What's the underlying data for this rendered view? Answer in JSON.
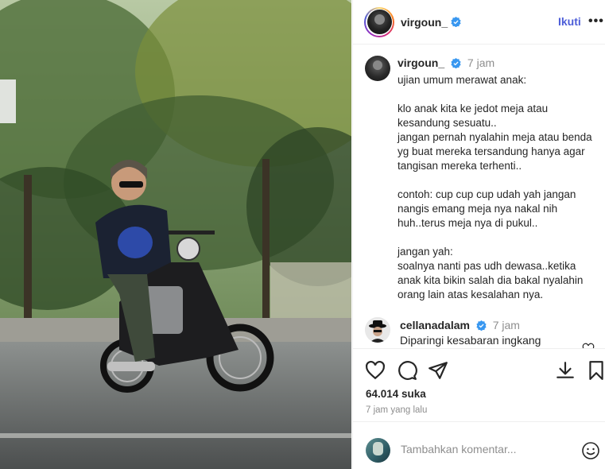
{
  "post": {
    "username": "virgoun_",
    "follow_label": "Ikuti",
    "more_label": "•••"
  },
  "caption": {
    "username": "virgoun_",
    "time": "7 jam",
    "text": "ujian umum merawat anak:\n\nklo anak kita ke jedot meja atau kesandung sesuatu..\njangan pernah nyalahin meja atau benda yg buat mereka tersandung hanya agar tangisan mereka terhenti..\n\ncontoh: cup cup cup udah yah jangan nangis emang meja nya nakal nih huh..terus meja nya di pukul..\n\njangan yah:\nsoalnya nanti pas udh dewasa..ketika anak kita bikin salah dia bakal nyalahin orang lain atas kesalahan nya."
  },
  "comment": {
    "username": "cellanadalam",
    "time": "7 jam",
    "text": "Diparingi kesabaran ingkang"
  },
  "actions": {
    "likes": "64.014 suka",
    "time": "7 jam yang lalu"
  },
  "add_comment": {
    "placeholder": "Tambahkan komentar..."
  },
  "colors": {
    "accent": "#4c5dd8",
    "verified": "#3897f0",
    "muted": "#8e8e8e"
  },
  "icons": [
    "verified-badge-icon",
    "heart-icon",
    "comment-icon",
    "share-icon",
    "download-icon",
    "bookmark-icon",
    "emoji-icon"
  ]
}
